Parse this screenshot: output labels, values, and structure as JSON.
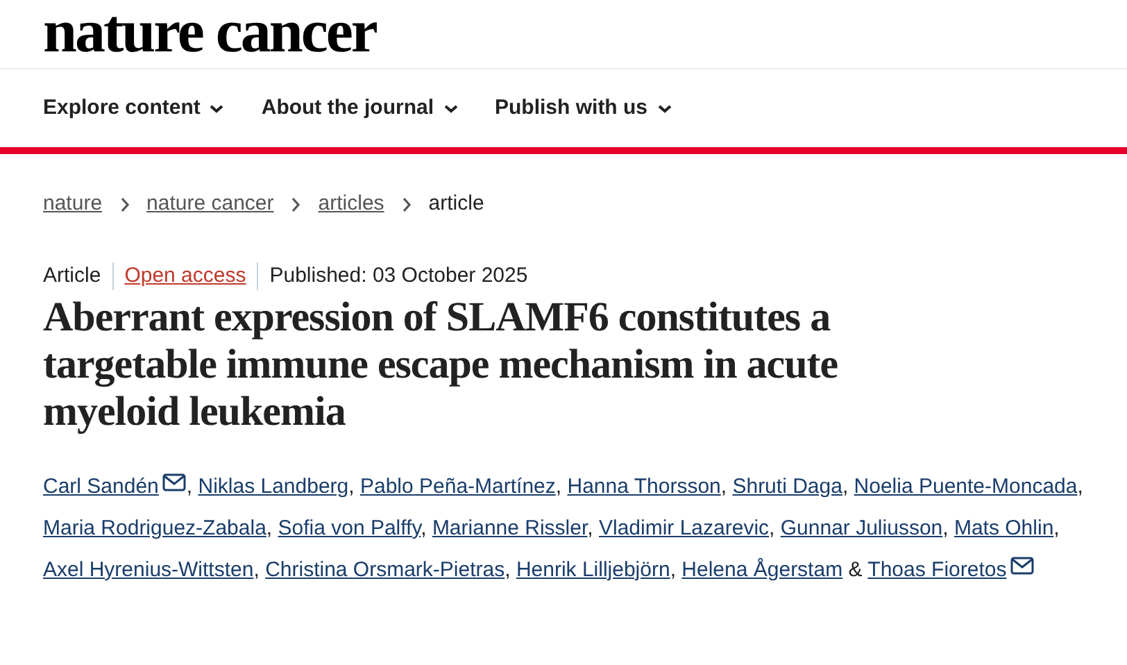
{
  "logo": "nature cancer",
  "nav": [
    {
      "label": "Explore content"
    },
    {
      "label": "About the journal"
    },
    {
      "label": "Publish with us"
    }
  ],
  "breadcrumbs": [
    {
      "label": "nature",
      "link": true
    },
    {
      "label": "nature cancer",
      "link": true
    },
    {
      "label": "articles",
      "link": true
    },
    {
      "label": "article",
      "link": false
    }
  ],
  "meta": {
    "type": "Article",
    "access": "Open access",
    "published": "Published: 03 October 2025"
  },
  "title": "Aberrant expression of SLAMF6 constitutes a targetable immune escape mechanism in acute myeloid leukemia",
  "authors": [
    {
      "name": "Carl Sandén",
      "mail": true,
      "sep": ","
    },
    {
      "name": "Niklas Landberg",
      "mail": false,
      "sep": ","
    },
    {
      "name": "Pablo Peña-Martínez",
      "mail": false,
      "sep": ","
    },
    {
      "name": "Hanna Thorsson",
      "mail": false,
      "sep": ","
    },
    {
      "name": "Shruti Daga",
      "mail": false,
      "sep": ","
    },
    {
      "name": "Noelia Puente-Moncada",
      "mail": false,
      "sep": ","
    },
    {
      "name": "Maria Rodriguez-Zabala",
      "mail": false,
      "sep": ","
    },
    {
      "name": "Sofia von Palffy",
      "mail": false,
      "sep": ","
    },
    {
      "name": "Marianne Rissler",
      "mail": false,
      "sep": ","
    },
    {
      "name": "Vladimir Lazarevic",
      "mail": false,
      "sep": ","
    },
    {
      "name": "Gunnar Juliusson",
      "mail": false,
      "sep": ","
    },
    {
      "name": "Mats Ohlin",
      "mail": false,
      "sep": ","
    },
    {
      "name": "Axel Hyrenius-Wittsten",
      "mail": false,
      "sep": ","
    },
    {
      "name": "Christina Orsmark-Pietras",
      "mail": false,
      "sep": ","
    },
    {
      "name": "Henrik Lilljebjörn",
      "mail": false,
      "sep": ","
    },
    {
      "name": "Helena Ågerstam",
      "mail": false,
      "sep": "&"
    },
    {
      "name": "Thoas Fioretos",
      "mail": true
    }
  ]
}
